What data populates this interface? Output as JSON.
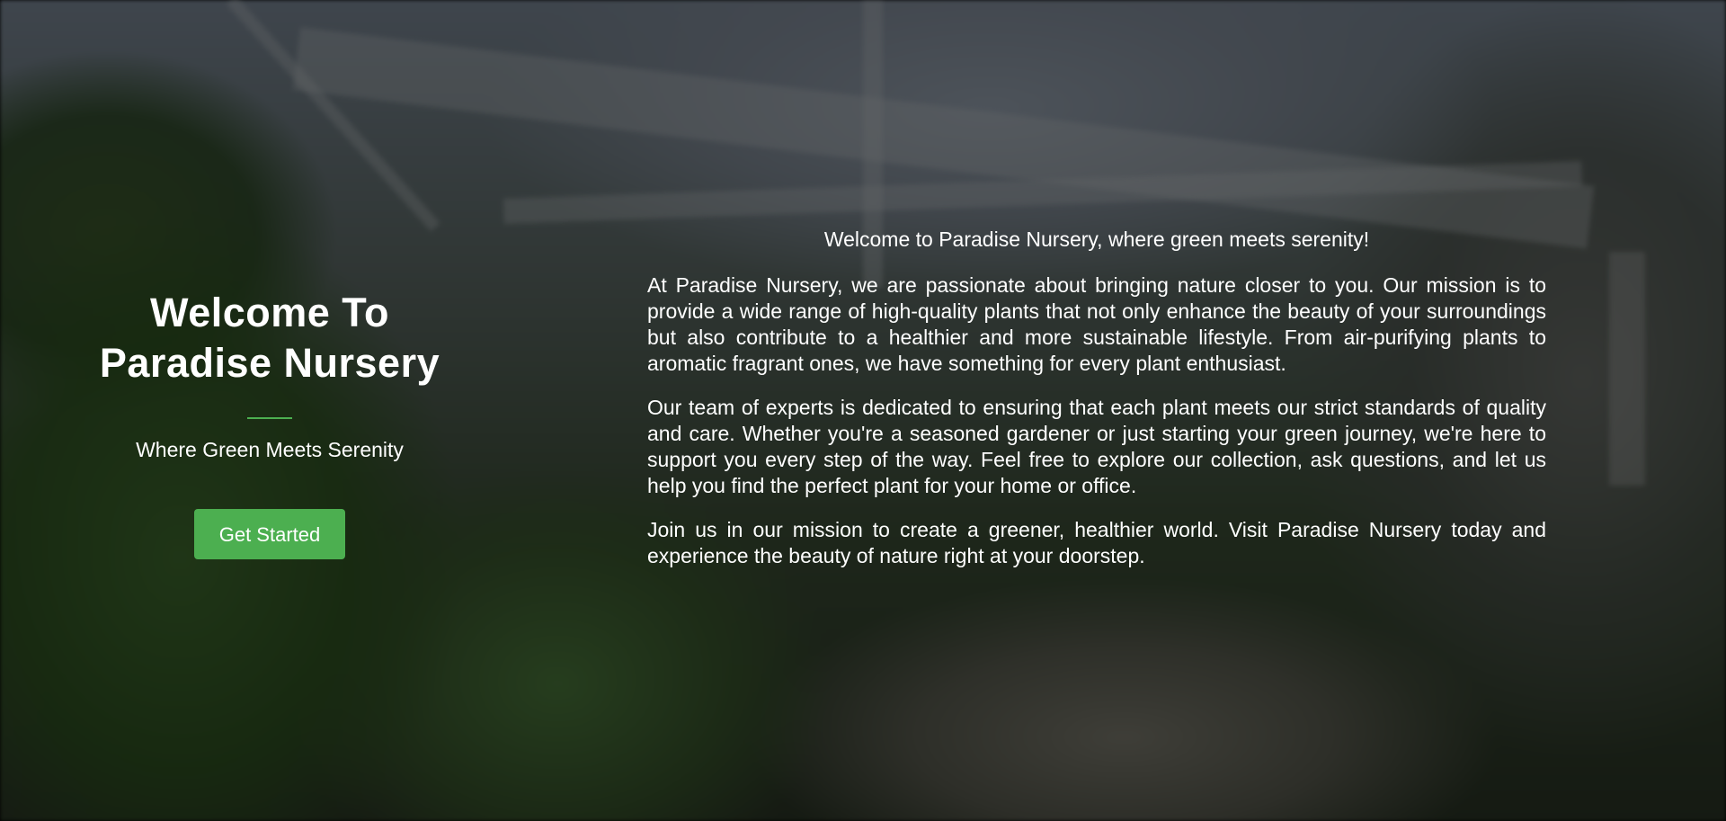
{
  "hero": {
    "title_line1": "Welcome To",
    "title_line2": "Paradise Nursery",
    "subtitle": "Where Green Meets Serenity",
    "cta_label": "Get Started",
    "accent_color": "#4caf50"
  },
  "about": {
    "intro": "Welcome to Paradise Nursery, where green meets serenity!",
    "paragraphs": [
      "At Paradise Nursery, we are passionate about bringing nature closer to you. Our mission is to provide a wide range of high-quality plants that not only enhance the beauty of your surroundings but also contribute to a healthier and more sustainable lifestyle. From air-purifying plants to aromatic fragrant ones, we have something for every plant enthusiast.",
      "Our team of experts is dedicated to ensuring that each plant meets our strict standards of quality and care. Whether you're a seasoned gardener or just starting your green journey, we're here to support you every step of the way. Feel free to explore our collection, ask questions, and let us help you find the perfect plant for your home or office.",
      "Join us in our mission to create a greener, healthier world. Visit Paradise Nursery today and experience the beauty of nature right at your doorstep."
    ]
  }
}
